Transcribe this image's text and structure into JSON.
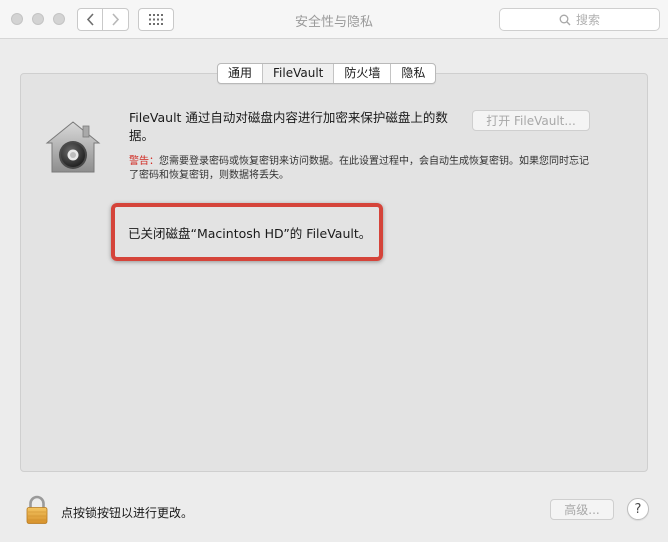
{
  "window": {
    "title": "安全性与隐私"
  },
  "toolbar": {
    "search_placeholder": "搜索"
  },
  "tabs": [
    {
      "label": "通用",
      "active": false
    },
    {
      "label": "FileVault",
      "active": true
    },
    {
      "label": "防火墙",
      "active": false
    },
    {
      "label": "隐私",
      "active": false
    }
  ],
  "filevault": {
    "description": "FileVault 通过自动对磁盘内容进行加密来保护磁盘上的数据。",
    "open_button": "打开 FileVault...",
    "warning_label": "警告：",
    "warning_text": "您需要登录密码或恢复密钥来访问数据。在此设置过程中，会自动生成恢复密钥。如果您同时忘记了密码和恢复密钥，则数据将丢失。",
    "status": "已关闭磁盘“Macintosh HD”的 FileVault。"
  },
  "footer": {
    "lock_text": "点按锁按钮以进行更改。",
    "advanced_button": "高级...",
    "help_button": "?"
  },
  "colors": {
    "highlight_border": "#d5443a",
    "warning_label": "#d0271f",
    "disabled_text": "#a8a8a8"
  },
  "icons": [
    "back-icon",
    "forward-icon",
    "grid-icon",
    "search-icon",
    "filevault-house-icon",
    "lock-icon",
    "help-icon"
  ]
}
